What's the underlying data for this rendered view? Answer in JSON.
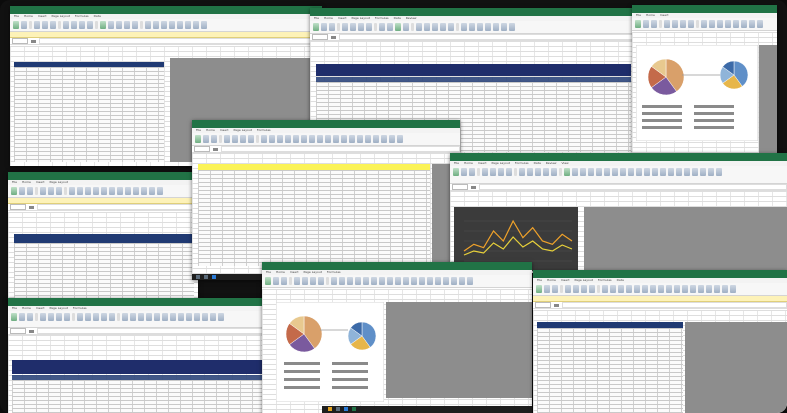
{
  "collage": "spreadsheet-screenshots",
  "ribbon_tabs": [
    "File",
    "Home",
    "Insert",
    "Page Layout",
    "Formulas",
    "Data",
    "Review",
    "View"
  ],
  "colors": {
    "excel_green": "#217346",
    "table_header_navy": "#203a73",
    "selection_yellow": "#fbf357",
    "chart_dark_bg": "#3b3b3b",
    "chart_line_orange": "#f0a22a",
    "chart_line_yellow": "#e8d13a"
  },
  "charts": {
    "pie_values_top": [
      40,
      25,
      20,
      15
    ],
    "pie_values_mid": [
      40,
      25,
      20,
      15
    ],
    "line_chart_values": [
      3,
      5,
      4,
      9,
      6,
      12,
      7,
      10,
      6,
      5,
      8,
      6
    ]
  }
}
